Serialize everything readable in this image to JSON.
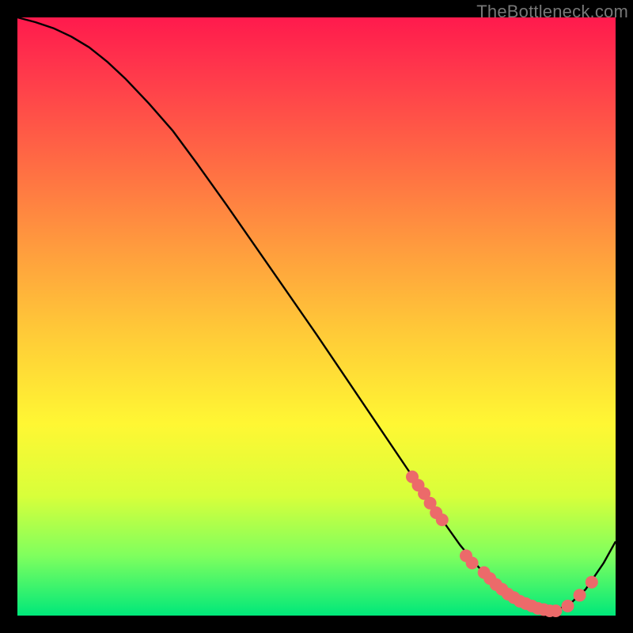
{
  "watermark": "TheBottleneck.com",
  "chart_data": {
    "type": "line",
    "title": "",
    "xlabel": "",
    "ylabel": "",
    "xlim": [
      0,
      100
    ],
    "ylim": [
      0,
      100
    ],
    "series": [
      {
        "name": "curve",
        "x": [
          0,
          3,
          6,
          9,
          12,
          15,
          18,
          22,
          26,
          30,
          35,
          40,
          45,
          50,
          55,
          60,
          65,
          68,
          71,
          74,
          77,
          80,
          83,
          86,
          89,
          92,
          95,
          98,
          100
        ],
        "y": [
          100,
          99.2,
          98.2,
          96.8,
          95,
          92.6,
          89.8,
          85.6,
          81,
          75.6,
          68.6,
          61.4,
          54.2,
          47,
          39.6,
          32.2,
          24.8,
          20.4,
          16,
          11.8,
          8.2,
          5.2,
          3,
          1.6,
          0.8,
          1.6,
          4.4,
          8.8,
          12.4
        ]
      }
    ],
    "markers": [
      {
        "x": 66,
        "y": 23.2
      },
      {
        "x": 67,
        "y": 21.8
      },
      {
        "x": 68,
        "y": 20.4
      },
      {
        "x": 69,
        "y": 18.8
      },
      {
        "x": 70,
        "y": 17.2
      },
      {
        "x": 71,
        "y": 16
      },
      {
        "x": 75,
        "y": 10
      },
      {
        "x": 76,
        "y": 8.8
      },
      {
        "x": 78,
        "y": 7.2
      },
      {
        "x": 79,
        "y": 6.2
      },
      {
        "x": 80,
        "y": 5.2
      },
      {
        "x": 81,
        "y": 4.4
      },
      {
        "x": 82,
        "y": 3.6
      },
      {
        "x": 83,
        "y": 3
      },
      {
        "x": 84,
        "y": 2.4
      },
      {
        "x": 85,
        "y": 2
      },
      {
        "x": 86,
        "y": 1.6
      },
      {
        "x": 87,
        "y": 1.2
      },
      {
        "x": 88,
        "y": 1
      },
      {
        "x": 89,
        "y": 0.8
      },
      {
        "x": 90,
        "y": 0.8
      },
      {
        "x": 92,
        "y": 1.6
      },
      {
        "x": 94,
        "y": 3.4
      },
      {
        "x": 96,
        "y": 5.6
      }
    ],
    "marker_color": "#ec6a6a",
    "marker_radius": 8,
    "gradient_stops": [
      {
        "offset": 0,
        "color": "#ff1a4d"
      },
      {
        "offset": 24,
        "color": "#ff6a44"
      },
      {
        "offset": 52,
        "color": "#ffc838"
      },
      {
        "offset": 68,
        "color": "#fff733"
      },
      {
        "offset": 90,
        "color": "#7fff5e"
      },
      {
        "offset": 100,
        "color": "#00e87a"
      }
    ]
  }
}
